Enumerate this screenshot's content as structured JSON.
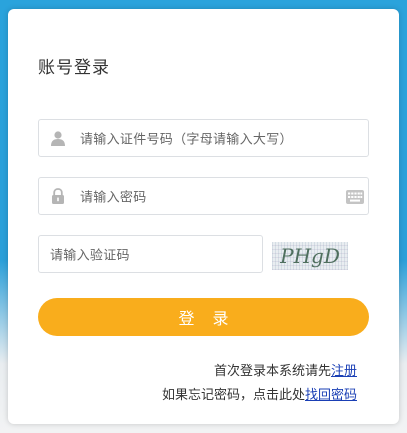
{
  "login": {
    "title": "账号登录",
    "id_placeholder": "请输入证件号码（字母请输入大写）",
    "password_placeholder": "请输入密码",
    "captcha_placeholder": "请输入验证码",
    "captcha_text": "PHgD",
    "submit_label": "登录",
    "first_login_text": "首次登录本系统请先",
    "register_link": "注册",
    "forgot_text": "如果忘记密码，点击此处",
    "recover_link": "找回密码"
  },
  "icons": {
    "user": "user-icon",
    "lock": "lock-icon",
    "keyboard": "keyboard-icon"
  },
  "colors": {
    "background_blue": "#2aa3dc",
    "button_orange": "#f9ad1c",
    "link_blue": "#1a3fb5"
  }
}
